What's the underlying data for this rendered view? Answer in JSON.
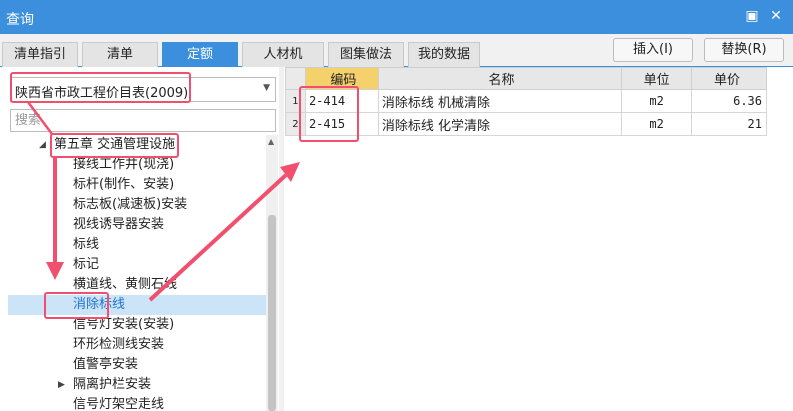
{
  "window": {
    "title": "查询",
    "restore_glyph": "▣",
    "close_glyph": "✕"
  },
  "tabs": [
    {
      "label": "清单指引",
      "active": false
    },
    {
      "label": "清单",
      "active": false
    },
    {
      "label": "定额",
      "active": true
    },
    {
      "label": "人材机",
      "active": false
    },
    {
      "label": "图集做法",
      "active": false
    },
    {
      "label": "我的数据",
      "active": false
    }
  ],
  "actions": {
    "insert_label": "插入(I)",
    "replace_label": "替换(R)"
  },
  "left": {
    "catalog_value": "陕西省市政工程价目表(2009)",
    "search_placeholder": "搜索",
    "tree": [
      {
        "label": "第五章 交通管理设施",
        "indent": 1,
        "expander": "◢",
        "selected": false
      },
      {
        "label": "接线工作井(现浇)",
        "indent": 2,
        "expander": "",
        "selected": false
      },
      {
        "label": "标杆(制作、安装)",
        "indent": 2,
        "expander": "",
        "selected": false
      },
      {
        "label": "标志板(减速板)安装",
        "indent": 2,
        "expander": "",
        "selected": false
      },
      {
        "label": "视线诱导器安装",
        "indent": 2,
        "expander": "",
        "selected": false
      },
      {
        "label": "标线",
        "indent": 2,
        "expander": "",
        "selected": false
      },
      {
        "label": "标记",
        "indent": 2,
        "expander": "",
        "selected": false
      },
      {
        "label": "横道线、黄侧石线",
        "indent": 2,
        "expander": "",
        "selected": false
      },
      {
        "label": "消除标线",
        "indent": 2,
        "expander": "",
        "selected": true
      },
      {
        "label": "信号灯安装(安装)",
        "indent": 2,
        "expander": "",
        "selected": false
      },
      {
        "label": "环形检测线安装",
        "indent": 2,
        "expander": "",
        "selected": false
      },
      {
        "label": "值警亭安装",
        "indent": 2,
        "expander": "",
        "selected": false
      },
      {
        "label": "隔离护栏安装",
        "indent": 2,
        "expander": "▶",
        "selected": false
      },
      {
        "label": "信号灯架空走线",
        "indent": 2,
        "expander": "",
        "selected": false
      }
    ]
  },
  "table": {
    "headers": {
      "code": "编码",
      "name": "名称",
      "unit": "单位",
      "price": "单价"
    },
    "rows": [
      {
        "num": "1",
        "code": "2-414",
        "name": "消除标线 机械清除",
        "unit": "m2",
        "price": "6.36"
      },
      {
        "num": "2",
        "code": "2-415",
        "name": "消除标线 化学清除",
        "unit": "m2",
        "price": "21"
      }
    ]
  },
  "colors": {
    "accent": "#3b8fdc",
    "annotation": "#f0506e",
    "selected_bg": "#cce4f7"
  }
}
